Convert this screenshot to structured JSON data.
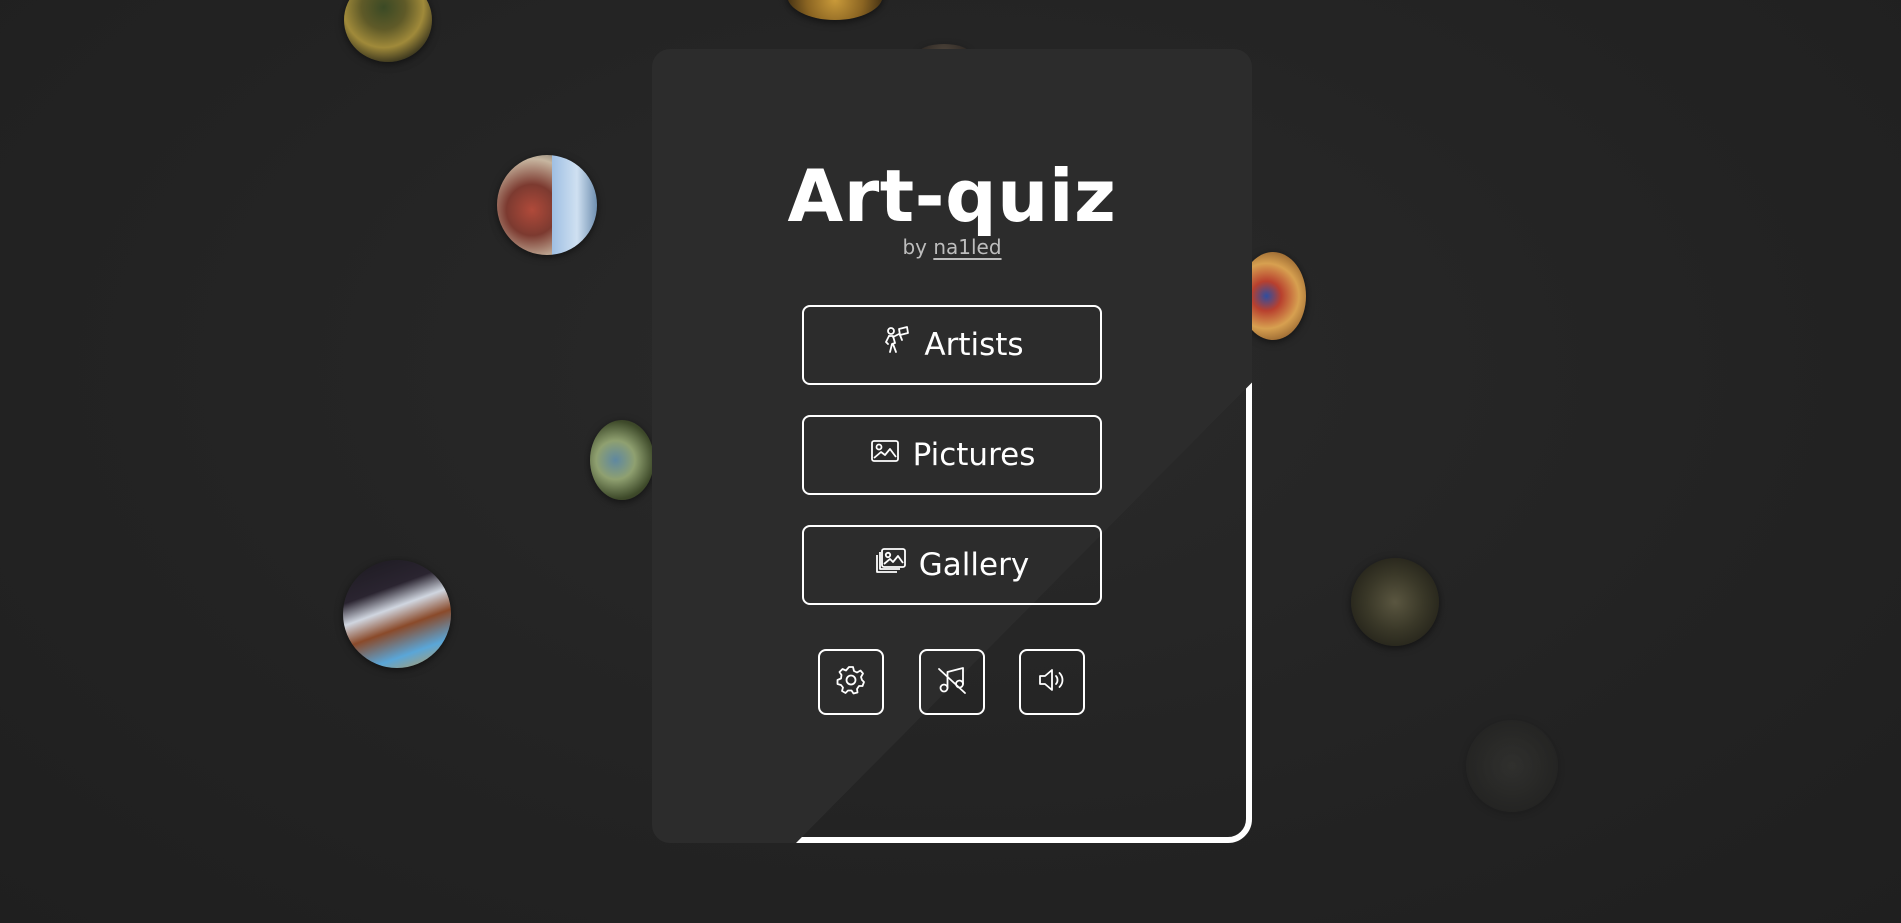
{
  "app": {
    "title": "Art-quiz",
    "byline_prefix": "by",
    "author": "na1led"
  },
  "menu": {
    "artists_label": "Artists",
    "pictures_label": "Pictures",
    "gallery_label": "Gallery"
  },
  "controls": {
    "settings_icon": "gear-icon",
    "music_icon": "music-off-icon",
    "sound_icon": "volume-icon"
  },
  "colors": {
    "background": "#262626",
    "card": "#2c2c2c",
    "accent": "#ffffff",
    "muted_text": "#bdbdbd"
  }
}
